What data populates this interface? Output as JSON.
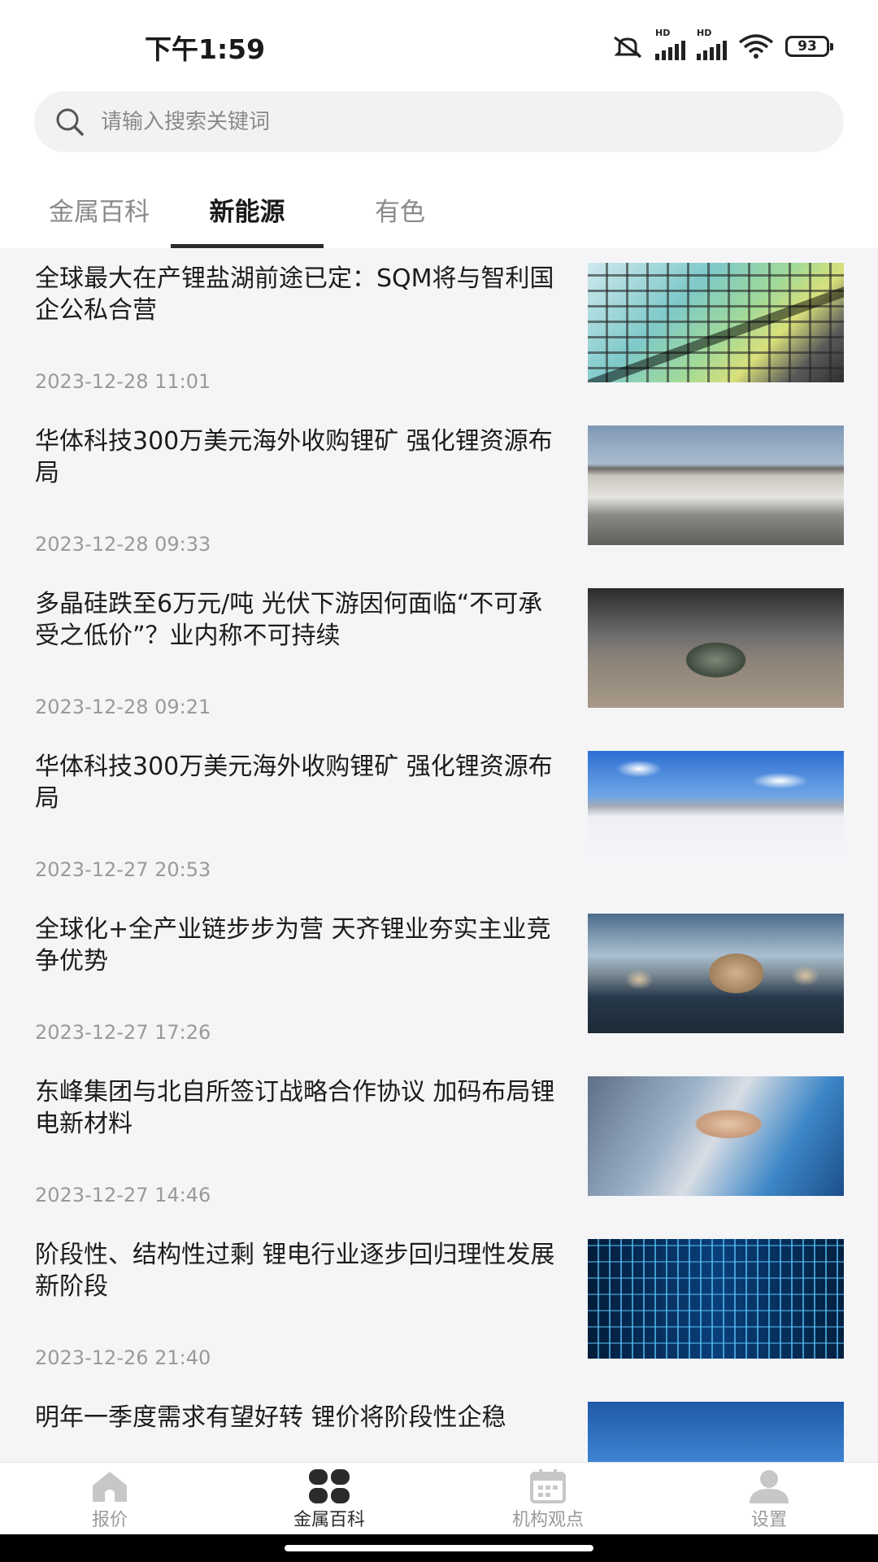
{
  "status_bar": {
    "time": "下午1:59",
    "battery": "93",
    "signal_label": "HD"
  },
  "search": {
    "placeholder": "请输入搜索关键词"
  },
  "tabs": [
    {
      "label": "金属百科",
      "active": false
    },
    {
      "label": "新能源",
      "active": true
    },
    {
      "label": "有色",
      "active": false
    }
  ],
  "news": [
    {
      "title": "全球最大在产锂盐湖前途已定：SQM将与智利国企公私合营",
      "date": "2023-12-28 11:01"
    },
    {
      "title": "华体科技300万美元海外收购锂矿 强化锂资源布局",
      "date": "2023-12-28 09:33"
    },
    {
      "title": "多晶硅跌至6万元/吨 光伏下游因何面临“不可承受之低价”？业内称不可持续",
      "date": "2023-12-28 09:21"
    },
    {
      "title": "华体科技300万美元海外收购锂矿 强化锂资源布局",
      "date": "2023-12-27 20:53"
    },
    {
      "title": "全球化+全产业链步步为营 天齐锂业夯实主业竞争优势",
      "date": "2023-12-27 17:26"
    },
    {
      "title": "东峰集团与北自所签订战略合作协议 加码布局锂电新材料",
      "date": "2023-12-27 14:46"
    },
    {
      "title": "阶段性、结构性过剩 锂电行业逐步回归理性发展新阶段",
      "date": "2023-12-26 21:40"
    },
    {
      "title": "明年一季度需求有望好转 锂价将阶段性企稳",
      "date": ""
    }
  ],
  "bottom_nav": [
    {
      "label": "报价",
      "icon": "home-icon",
      "active": false
    },
    {
      "label": "金属百科",
      "icon": "grid-icon",
      "active": true
    },
    {
      "label": "机构观点",
      "icon": "calendar-icon",
      "active": false
    },
    {
      "label": "设置",
      "icon": "user-icon",
      "active": false
    }
  ],
  "colors": {
    "accent": "#2b2b2b",
    "inactive": "#9a9a9a",
    "background": "#f5f5f7"
  }
}
